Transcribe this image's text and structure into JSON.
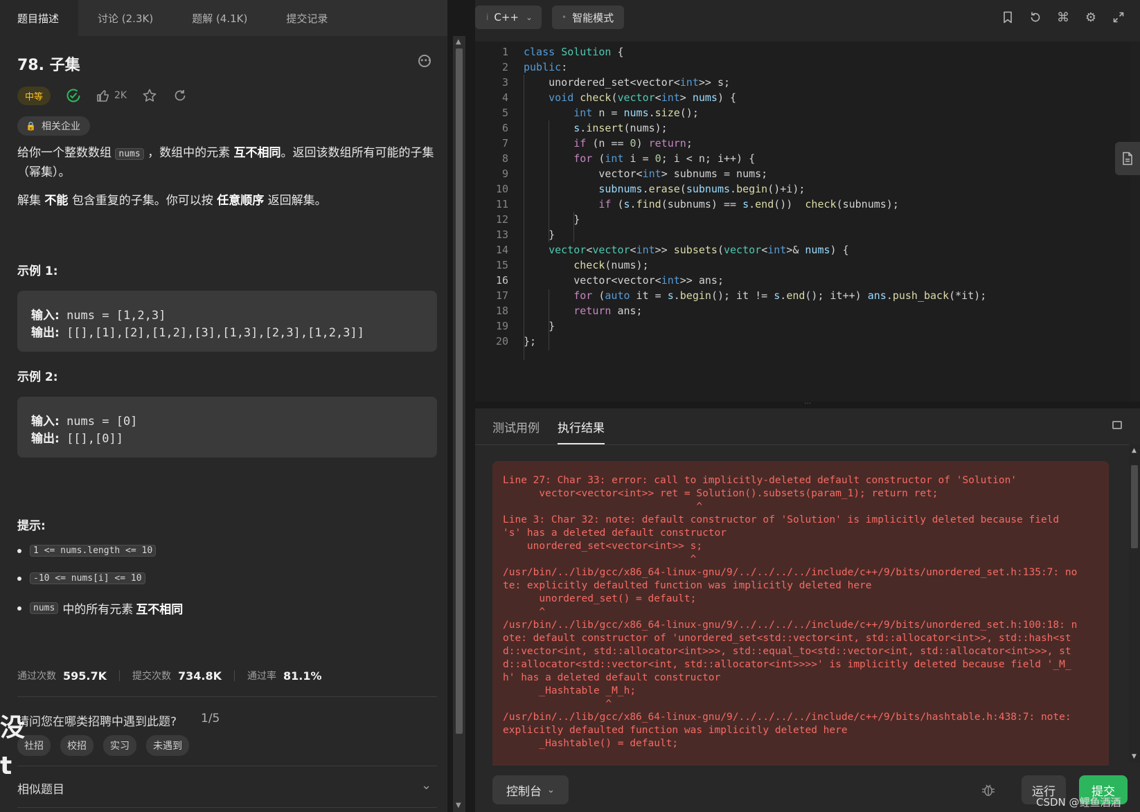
{
  "left_tabs": [
    "题目描述",
    "讨论 (2.3K)",
    "题解 (4.1K)",
    "提交记录"
  ],
  "problem": {
    "title": "78. 子集",
    "difficulty": "中等",
    "likes": "2K",
    "company_tag": "相关企业",
    "desc1_a": "给你一个整数数组",
    "desc1_code": "nums",
    "desc1_b": "，数组中的元素",
    "desc1_bold": "互不相同",
    "desc1_c": "。返回该数组所有可能的子集（幂集）。",
    "desc2_a": "解集",
    "desc2_bold1": "不能",
    "desc2_b": "包含重复的子集。你可以按",
    "desc2_bold2": "任意顺序",
    "desc2_c": "返回解集。"
  },
  "examples": [
    {
      "title": "示例 1:",
      "input_label": "输入:",
      "input": "nums = [1,2,3]",
      "output_label": "输出:",
      "output": "[[],[1],[2],[1,2],[3],[1,3],[2,3],[1,2,3]]"
    },
    {
      "title": "示例 2:",
      "input_label": "输入:",
      "input": "nums = [0]",
      "output_label": "输出:",
      "output": "[[],[0]]"
    }
  ],
  "hints": {
    "title": "提示:",
    "items": [
      "1 <= nums.length <= 10",
      "-10 <= nums[i] <= 10"
    ],
    "third_code": "nums",
    "third_text": "中的所有元素",
    "third_bold": "互不相同"
  },
  "stats": {
    "passed_label": "通过次数",
    "passed": "595.7K",
    "submitted_label": "提交次数",
    "submitted": "734.8K",
    "rate_label": "通过率",
    "rate": "81.1%"
  },
  "survey": {
    "question": "请问您在哪类招聘中遇到此题?",
    "progress": "1/5",
    "options": [
      "社招",
      "校招",
      "实习",
      "未遇到"
    ]
  },
  "similar_label": "相似题目",
  "side_glyphs": [
    "没",
    "t"
  ],
  "editor": {
    "language": "C++",
    "mode": "智能模式",
    "current_line": 16,
    "lines": [
      "class Solution {",
      "public:",
      "    unordered_set<vector<int>> s;",
      "    void check(vector<int> nums) {",
      "        int n = nums.size();",
      "        s.insert(nums);",
      "        if (n == 0) return;",
      "        for (int i = 0; i < n; i++) {",
      "            vector<int> subnums = nums;",
      "            subnums.erase(subnums.begin()+i);",
      "            if (s.find(subnums) == s.end())  check(subnums);",
      "        }",
      "    }",
      "    vector<vector<int>> subsets(vector<int>& nums) {",
      "        check(nums);",
      "        vector<vector<int>> ans;",
      "        for (auto it = s.begin(); it != s.end(); it++) ans.push_back(*it);",
      "        return ans;",
      "    }",
      "};"
    ]
  },
  "result": {
    "tabs": [
      "测试用例",
      "执行结果"
    ],
    "active_tab": "执行结果",
    "error_lines": [
      "Line 27: Char 33: error: call to implicitly-deleted default constructor of 'Solution'",
      "      vector<vector<int>> ret = Solution().subsets(param_1); return ret;",
      "                                ^",
      "Line 3: Char 32: note: default constructor of 'Solution' is implicitly deleted because field",
      "'s' has a deleted default constructor",
      "    unordered_set<vector<int>> s;",
      "                               ^",
      "/usr/bin/../lib/gcc/x86_64-linux-gnu/9/../../../../include/c++/9/bits/unordered_set.h:135:7: no",
      "te: explicitly defaulted function was implicitly deleted here",
      "      unordered_set() = default;",
      "      ^",
      "/usr/bin/../lib/gcc/x86_64-linux-gnu/9/../../../../include/c++/9/bits/unordered_set.h:100:18: n",
      "ote: default constructor of 'unordered_set<std::vector<int, std::allocator<int>>, std::hash<st",
      "d::vector<int, std::allocator<int>>>, std::equal_to<std::vector<int, std::allocator<int>>>, st",
      "d::allocator<std::vector<int, std::allocator<int>>>>' is implicitly deleted because field '_M_",
      "h' has a deleted default constructor",
      "      _Hashtable _M_h;",
      "                 ^",
      "/usr/bin/../lib/gcc/x86_64-linux-gnu/9/../../../../include/c++/9/bits/hashtable.h:438:7: note:",
      "explicitly defaulted function was implicitly deleted here",
      "      _Hashtable() = default;"
    ],
    "console_label": "控制台",
    "run_label": "运行",
    "submit_label": "提交",
    "watermark": "CSDN @鲤鱼酒酒"
  }
}
